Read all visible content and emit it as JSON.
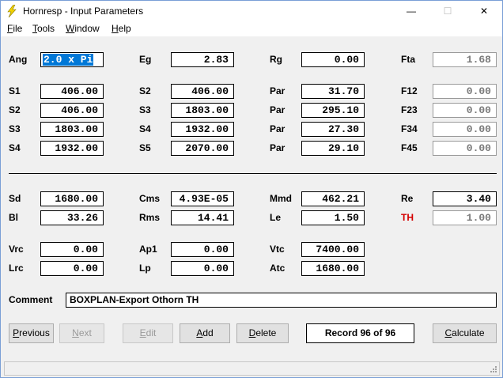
{
  "window": {
    "title": "Hornresp - Input Parameters",
    "controls": {
      "minimize": "—",
      "maximize": "☐",
      "close": "✕"
    }
  },
  "menu": {
    "file": {
      "u": "F",
      "rest": "ile"
    },
    "tools": {
      "u": "T",
      "rest": "ools"
    },
    "window": {
      "u": "W",
      "rest": "indow"
    },
    "help": {
      "u": "H",
      "rest": "elp"
    }
  },
  "params": {
    "ang": {
      "label": "Ang",
      "value": "2.0 x Pi"
    },
    "eg": {
      "label": "Eg",
      "value": "2.83"
    },
    "rg": {
      "label": "Rg",
      "value": "0.00"
    },
    "fta": {
      "label": "Fta",
      "value": "1.68"
    },
    "s1a": {
      "label": "S1",
      "value": "406.00"
    },
    "s2b": {
      "label": "S2",
      "value": "406.00"
    },
    "par1": {
      "label": "Par",
      "value": "31.70"
    },
    "f12": {
      "label": "F12",
      "value": "0.00"
    },
    "s2a": {
      "label": "S2",
      "value": "406.00"
    },
    "s3b": {
      "label": "S3",
      "value": "1803.00"
    },
    "par2": {
      "label": "Par",
      "value": "295.10"
    },
    "f23": {
      "label": "F23",
      "value": "0.00"
    },
    "s3a": {
      "label": "S3",
      "value": "1803.00"
    },
    "s4b": {
      "label": "S4",
      "value": "1932.00"
    },
    "par3": {
      "label": "Par",
      "value": "27.30"
    },
    "f34": {
      "label": "F34",
      "value": "0.00"
    },
    "s4a": {
      "label": "S4",
      "value": "1932.00"
    },
    "s5b": {
      "label": "S5",
      "value": "2070.00"
    },
    "par4": {
      "label": "Par",
      "value": "29.10"
    },
    "f45": {
      "label": "F45",
      "value": "0.00"
    },
    "sd": {
      "label": "Sd",
      "value": "1680.00"
    },
    "cms": {
      "label": "Cms",
      "value": "4.93E-05"
    },
    "mmd": {
      "label": "Mmd",
      "value": "462.21"
    },
    "re": {
      "label": "Re",
      "value": "3.40"
    },
    "bl": {
      "label": "Bl",
      "value": "33.26"
    },
    "rms": {
      "label": "Rms",
      "value": "14.41"
    },
    "le": {
      "label": "Le",
      "value": "1.50"
    },
    "th": {
      "label": "TH",
      "value": "1.00"
    },
    "vrc": {
      "label": "Vrc",
      "value": "0.00"
    },
    "ap1": {
      "label": "Ap1",
      "value": "0.00"
    },
    "vtc": {
      "label": "Vtc",
      "value": "7400.00"
    },
    "lrc": {
      "label": "Lrc",
      "value": "0.00"
    },
    "lp": {
      "label": "Lp",
      "value": "0.00"
    },
    "atc": {
      "label": "Atc",
      "value": "1680.00"
    }
  },
  "comment": {
    "label": "Comment",
    "value": "BOXPLAN-Export Othorn TH"
  },
  "buttons": {
    "previous": {
      "u": "P",
      "rest": "revious"
    },
    "next": {
      "u": "N",
      "rest": "ext"
    },
    "edit": {
      "u": "E",
      "rest": "dit"
    },
    "add": {
      "u": "A",
      "rest": "dd"
    },
    "delete": {
      "u": "D",
      "rest": "elete"
    },
    "calculate": {
      "u": "C",
      "rest": "alculate"
    }
  },
  "record": "Record 96 of 96",
  "colors": {
    "selection": "#0078d7",
    "th_label": "#d40000",
    "icon": "#f2d200"
  }
}
